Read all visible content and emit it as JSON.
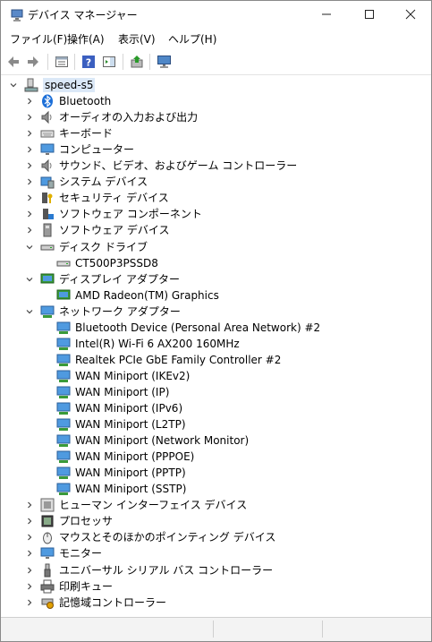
{
  "window": {
    "title": "デバイス マネージャー"
  },
  "menu": [
    "ファイル(F)",
    "操作(A)",
    "表示(V)",
    "ヘルプ(H)"
  ],
  "tree": {
    "root": "speed-s5",
    "categories": [
      {
        "label": "Bluetooth",
        "icon": "bluetooth-icon",
        "expanded": false
      },
      {
        "label": "オーディオの入力および出力",
        "icon": "speaker-icon",
        "expanded": false
      },
      {
        "label": "キーボード",
        "icon": "keyboard-icon",
        "expanded": false
      },
      {
        "label": "コンピューター",
        "icon": "monitor-icon",
        "expanded": false
      },
      {
        "label": "サウンド、ビデオ、およびゲーム コントローラー",
        "icon": "speaker-icon",
        "expanded": false
      },
      {
        "label": "システム デバイス",
        "icon": "system-icon",
        "expanded": false
      },
      {
        "label": "セキュリティ デバイス",
        "icon": "security-icon",
        "expanded": false
      },
      {
        "label": "ソフトウェア コンポーネント",
        "icon": "component-icon",
        "expanded": false
      },
      {
        "label": "ソフトウェア デバイス",
        "icon": "device-icon",
        "expanded": false
      },
      {
        "label": "ディスク ドライブ",
        "icon": "disk-icon",
        "expanded": true,
        "children": [
          "CT500P3PSSD8"
        ]
      },
      {
        "label": "ディスプレイ アダプター",
        "icon": "display-adapter-icon",
        "expanded": true,
        "children": [
          "AMD Radeon(TM) Graphics"
        ]
      },
      {
        "label": "ネットワーク アダプター",
        "icon": "network-icon",
        "expanded": true,
        "children": [
          "Bluetooth Device (Personal Area Network) #2",
          "Intel(R) Wi-Fi 6 AX200 160MHz",
          "Realtek PCIe GbE Family Controller #2",
          "WAN Miniport (IKEv2)",
          "WAN Miniport (IP)",
          "WAN Miniport (IPv6)",
          "WAN Miniport (L2TP)",
          "WAN Miniport (Network Monitor)",
          "WAN Miniport (PPPOE)",
          "WAN Miniport (PPTP)",
          "WAN Miniport (SSTP)"
        ]
      },
      {
        "label": "ヒューマン インターフェイス デバイス",
        "icon": "hid-icon",
        "expanded": false
      },
      {
        "label": "プロセッサ",
        "icon": "processor-icon",
        "expanded": false
      },
      {
        "label": "マウスとそのほかのポインティング デバイス",
        "icon": "mouse-icon",
        "expanded": false
      },
      {
        "label": "モニター",
        "icon": "monitor-icon",
        "expanded": false
      },
      {
        "label": "ユニバーサル シリアル バス コントローラー",
        "icon": "usb-icon",
        "expanded": false
      },
      {
        "label": "印刷キュー",
        "icon": "printer-icon",
        "expanded": false
      },
      {
        "label": "記憶域コントローラー",
        "icon": "storage-icon",
        "expanded": false
      }
    ]
  }
}
